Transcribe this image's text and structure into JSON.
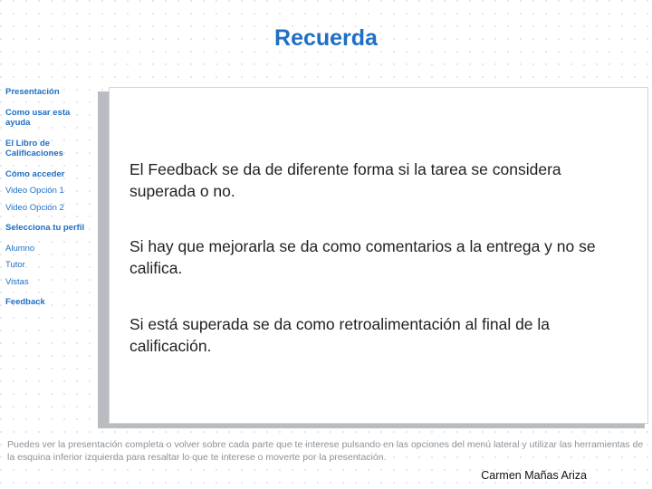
{
  "slide": {
    "title": "Recuerda",
    "sidebar": {
      "items": [
        {
          "label": "Presentación",
          "style": "bold",
          "gap": "none"
        },
        {
          "label": "Como usar esta ayuda",
          "style": "bold",
          "gap": "md"
        },
        {
          "label": "El Libro de Calificaciones",
          "style": "bold",
          "gap": "md"
        },
        {
          "label": "Cómo acceder",
          "style": "bold",
          "gap": "md"
        },
        {
          "label": "Video Opción 1",
          "style": "plain",
          "gap": "sm"
        },
        {
          "label": "Video Opción 2",
          "style": "plain",
          "gap": "sm"
        },
        {
          "label": "Selecciona tu perfil",
          "style": "bold",
          "gap": "md"
        },
        {
          "label": "Alumno",
          "style": "plain",
          "gap": "md"
        },
        {
          "label": "Tutor",
          "style": "plain",
          "gap": "sm"
        },
        {
          "label": "Vistas",
          "style": "plain",
          "gap": "sm"
        },
        {
          "label": "Feedback",
          "style": "bold",
          "gap": "md"
        }
      ]
    },
    "body": {
      "paragraph_1": "El Feedback se da de diferente forma si la tarea se considera superada o no.",
      "paragraph_2": "Si hay que mejorarla se da como comentarios a la entrega y no se califica.",
      "paragraph_3": "Si está superada se da como retroalimentación al final de la calificación."
    },
    "footnote": "Puedes ver la presentación completa o volver sobre cada parte que te interese pulsando en las opciones del menú lateral y utilizar las herramientas de la esquina inferior izquierda para resaltar lo que te interese o moverte por la presentación.",
    "author": "Carmen Mañas Ariza",
    "colors": {
      "accent": "#1f6fc4",
      "text": "#222222",
      "footnote": "#8e9499",
      "panel_border": "#d2d4d6",
      "panel_shadow": "#b9bcc0"
    }
  }
}
